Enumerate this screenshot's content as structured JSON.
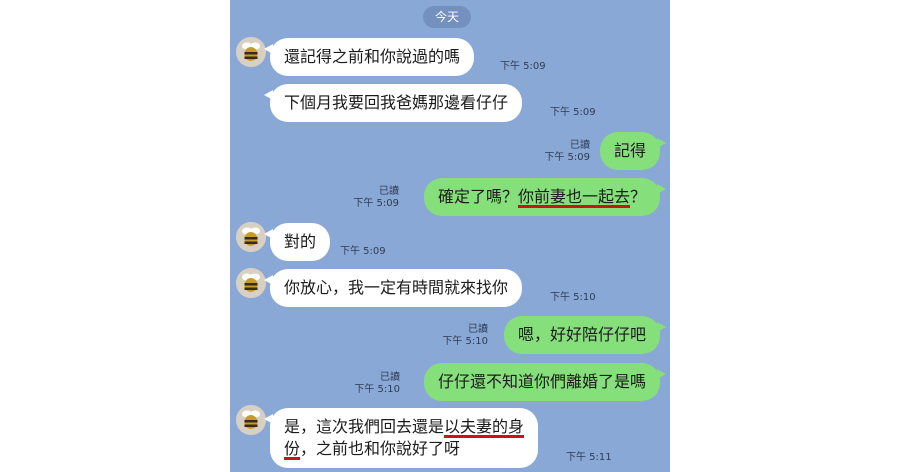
{
  "date_label": "今天",
  "messages": [
    {
      "side": "in",
      "text": "還記得之前和你說過的嗎",
      "time": "下午 5:09"
    },
    {
      "side": "in",
      "text": "下個月我要回我爸媽那邊看仔仔",
      "time": "下午 5:09"
    },
    {
      "side": "out",
      "text": "記得",
      "read": "已讀",
      "time": "下午 5:09"
    },
    {
      "side": "out",
      "text_pre": "確定了嗎？",
      "text_mark": "你前妻也一起去",
      "text_post": "？",
      "read": "已讀",
      "time": "下午 5:09"
    },
    {
      "side": "in",
      "text": "對的",
      "time": "下午 5:09"
    },
    {
      "side": "in",
      "text": "你放心，我一定有時間就來找你",
      "time": "下午 5:10"
    },
    {
      "side": "out",
      "text": "嗯，好好陪仔仔吧",
      "read": "已讀",
      "time": "下午 5:10"
    },
    {
      "side": "out",
      "text": "仔仔還不知道你們離婚了是嗎",
      "read": "已讀",
      "time": "下午 5:10"
    },
    {
      "side": "in",
      "text_pre": "是，這次我們回去還是",
      "text_mark": "以夫妻的身份",
      "text_mark_a": "以夫妻的身",
      "text_mark_b": "份",
      "text_post": "，之前也和你說好了呀",
      "time": "下午 5:11"
    }
  ],
  "colors": {
    "chat_bg": "#8aa8d6",
    "outgoing": "#85e07b",
    "incoming": "#ffffff",
    "underline": "#c81414"
  }
}
